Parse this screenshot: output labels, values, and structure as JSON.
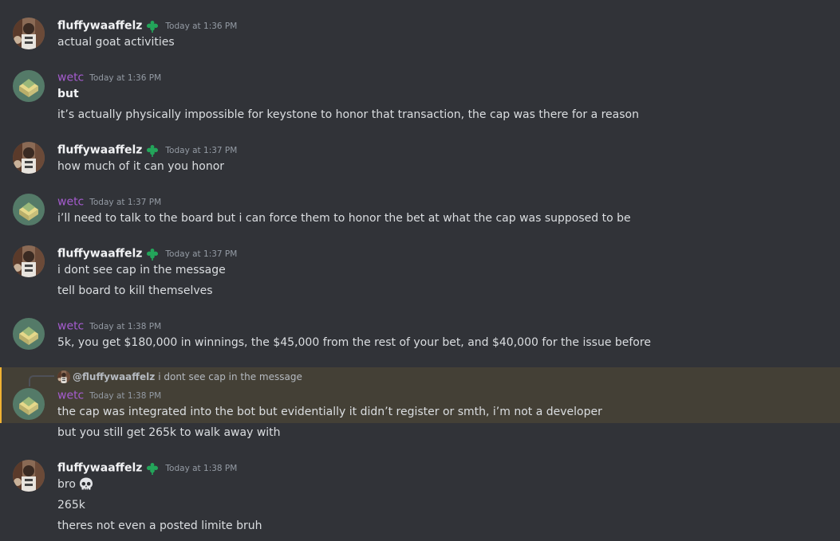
{
  "messages": [
    {
      "user": "fluffywaaffelz",
      "time": "Today at 1:36 PM",
      "lines": [
        "actual goat activities"
      ]
    },
    {
      "user": "wetc",
      "time": "Today at 1:36 PM",
      "lines": [
        "but",
        "it’s actually physically impossible for keystone to honor that transaction, the cap was there for a reason"
      ]
    },
    {
      "user": "fluffywaaffelz",
      "time": "Today at 1:37 PM",
      "lines": [
        "how much of it can you honor"
      ]
    },
    {
      "user": "wetc",
      "time": "Today at 1:37 PM",
      "lines": [
        "i’ll need to talk to the board but i can force them to honor the bet at what the cap was supposed to be"
      ]
    },
    {
      "user": "fluffywaaffelz",
      "time": "Today at 1:37 PM",
      "lines": [
        "i dont see cap in the message",
        "tell board to kill themselves"
      ]
    },
    {
      "user": "wetc",
      "time": "Today at 1:38 PM",
      "lines": [
        "5k, you get $180,000 in winnings, the $45,000 from the rest of your bet, and $40,000 for the issue before"
      ]
    },
    {
      "user": "wetc",
      "time": "Today at 1:38 PM",
      "reply": {
        "user": "@fluffywaaffelz",
        "text": "i dont see cap in the message"
      },
      "lines": [
        "the cap was integrated into the bot but evidentially it didn’t register or smth, i’m not a developer",
        "but you still get 265k to walk away with"
      ]
    },
    {
      "user": "fluffywaaffelz",
      "time": "Today at 1:38 PM",
      "lines": [
        "bro",
        "265k",
        "theres not even a posted limite bruh"
      ]
    }
  ],
  "icons": {
    "badge": "leaf-badge-icon",
    "emoji": "skull-emoji"
  },
  "colors": {
    "background": "#313338",
    "wetc_name": "#a55ccf",
    "highlight": "#444036",
    "highlight_bar": "#f0b232",
    "badge": "#23a55a"
  }
}
